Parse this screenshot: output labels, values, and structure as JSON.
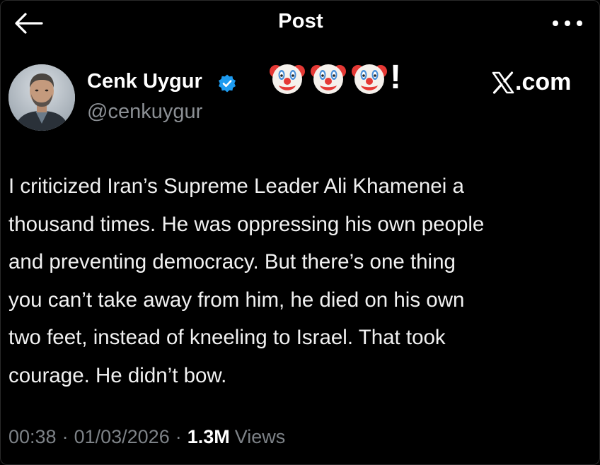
{
  "header": {
    "title": "Post"
  },
  "author": {
    "name": "Cenk Uygur",
    "handle": "@cenkuygur",
    "verified": true
  },
  "overlay": {
    "reaction_emojis": [
      "clown-face",
      "clown-face",
      "clown-face"
    ],
    "reaction_suffix": "!",
    "site_label": ".com"
  },
  "post": {
    "text": "I criticized Iran’s Supreme Leader Ali Khamenei a\nthousand times. He was oppressing his own people\nand preventing democracy. But there’s one thing\nyou can’t take away from him, he died on his own\ntwo feet, instead of kneeling to Israel. That took\ncourage. He didn’t bow.",
    "time": "00:38",
    "date": "01/03/2026",
    "separator": "·",
    "views_count": "1.3M",
    "views_label": "Views"
  },
  "colors": {
    "background": "#000000",
    "text": "#f1f1f1",
    "secondary": "#7d8287",
    "verified_badge": "#1d9bf0"
  },
  "icons": {
    "back": "back-arrow-icon",
    "more": "more-dots-icon",
    "verified": "verified-badge-icon",
    "logo": "x-logo-icon"
  }
}
